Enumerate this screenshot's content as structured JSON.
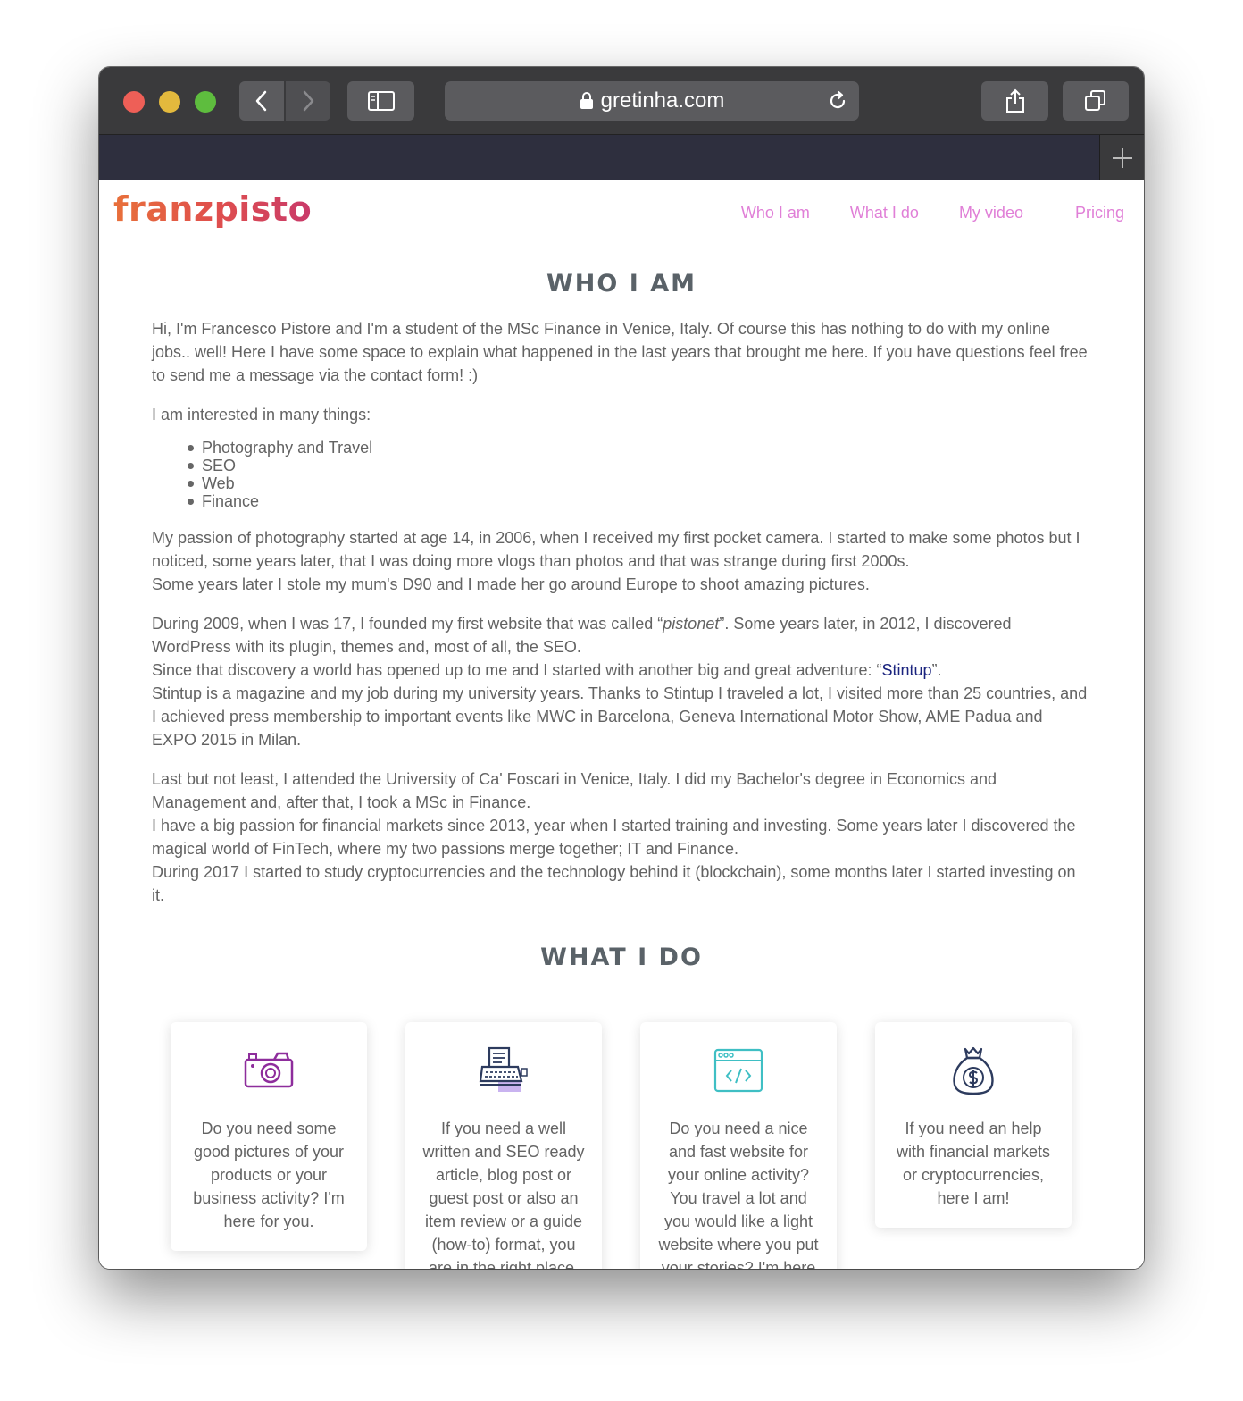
{
  "browser": {
    "url": "gretinha.com"
  },
  "site": {
    "logo": "franzpisto",
    "nav": [
      "Who I am",
      "What I do",
      "My video",
      "Pricing"
    ]
  },
  "who": {
    "title": "WHO I AM",
    "intro": "Hi, I'm Francesco Pistore and I'm a student of the MSc Finance in Venice, Italy. Of course this has nothing to do with my online jobs.. well! Here I have some space to explain what happened in the last years that brought me here. If you have questions feel free to send me a message via the contact form! :)",
    "interests_intro": "I am interested in many things:",
    "interests": [
      "Photography and Travel",
      "SEO",
      "Web",
      "Finance"
    ],
    "photo_p1": "My passion of photography started at age 14, in 2006, when I received my first pocket camera. I started to make some photos but I noticed, some years later, that I was doing more vlogs than photos and that was strange during first 2000s.",
    "photo_p2": "Some years later I stole my mum's D90 and I made her go around Europe to shoot amazing pictures.",
    "web_p1_a": "During 2009, when I was 17, I founded my first website that was called “",
    "web_p1_em": "pistonet",
    "web_p1_b": "”. Some years later, in 2012, I discovered WordPress with its plugin, themes and, most of all, the SEO.",
    "web_p2_a": "Since that discovery a world has opened up to me and I started with another big and great adventure: “",
    "web_p2_link": "Stintup",
    "web_p2_b": "”.",
    "web_p3": "Stintup is a magazine and my job during my university years. Thanks to Stintup I traveled a lot, I visited more than 25 countries, and I achieved press membership to important events like MWC in Barcelona, Geneva International Motor Show, AME Padua and EXPO 2015 in Milan.",
    "edu_p1": "Last but not least, I attended the University of Ca' Foscari in Venice, Italy. I did my Bachelor's degree in Economics and Management and, after that, I took a MSc in Finance.",
    "edu_p2": "I have a big passion for financial markets since 2013, year when I started training and investing. Some years later I discovered the magical world of FinTech, where my two passions merge together; IT and Finance.",
    "edu_p3": "During 2017 I started to study cryptocurrencies and the technology behind it (blockchain), some months later I started investing on it."
  },
  "what": {
    "title": "WHAT I DO",
    "cards": [
      {
        "icon": "camera-icon",
        "text": "Do you need some good pictures of your products or your business activity? I'm here for you."
      },
      {
        "icon": "typewriter-icon",
        "text": "If you need a well written and SEO ready article, blog post or guest post or also an item review or a guide (how-to) format, you are in the right place."
      },
      {
        "icon": "code-window-icon",
        "text": "Do you need a nice and fast website for your online activity? You travel a lot and you would like a light website where you put your stories? I'm here"
      },
      {
        "icon": "money-bag-icon",
        "text": "If you need an help with financial markets or cryptocurrencies, here I am!"
      }
    ]
  },
  "colors": {
    "nav_link": "#e07fd7",
    "logo_start": "#e8703a",
    "logo_end": "#c93a6a",
    "link": "#1a237e"
  }
}
